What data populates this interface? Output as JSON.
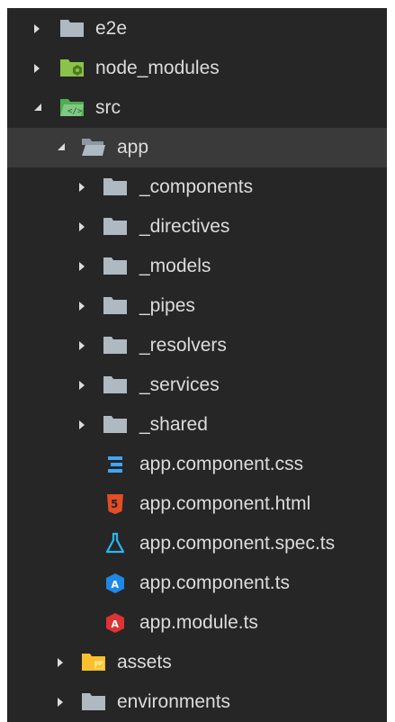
{
  "tree": {
    "items": [
      {
        "label": "e2e",
        "icon": "folder-icon",
        "state": "collapsed",
        "depth": 0
      },
      {
        "label": "node_modules",
        "icon": "node-folder-icon",
        "state": "collapsed",
        "depth": 0
      },
      {
        "label": "src",
        "icon": "src-folder-icon",
        "state": "expanded",
        "depth": 0
      },
      {
        "label": "app",
        "icon": "folder-open-icon",
        "state": "expanded",
        "depth": 1,
        "selected": true
      },
      {
        "label": "_components",
        "icon": "folder-icon",
        "state": "collapsed",
        "depth": 2
      },
      {
        "label": "_directives",
        "icon": "folder-icon",
        "state": "collapsed",
        "depth": 2
      },
      {
        "label": "_models",
        "icon": "folder-icon",
        "state": "collapsed",
        "depth": 2
      },
      {
        "label": "_pipes",
        "icon": "folder-icon",
        "state": "collapsed",
        "depth": 2
      },
      {
        "label": "_resolvers",
        "icon": "folder-icon",
        "state": "collapsed",
        "depth": 2
      },
      {
        "label": "_services",
        "icon": "folder-icon",
        "state": "collapsed",
        "depth": 2
      },
      {
        "label": "_shared",
        "icon": "folder-icon",
        "state": "collapsed",
        "depth": 2
      },
      {
        "label": "app.component.css",
        "icon": "css-file-icon",
        "state": "file",
        "depth": 2
      },
      {
        "label": "app.component.html",
        "icon": "html-file-icon",
        "state": "file",
        "depth": 2
      },
      {
        "label": "app.component.spec.ts",
        "icon": "test-flask-icon",
        "state": "file",
        "depth": 2
      },
      {
        "label": "app.component.ts",
        "icon": "angular-component-icon",
        "state": "file",
        "depth": 2
      },
      {
        "label": "app.module.ts",
        "icon": "angular-module-icon",
        "state": "file",
        "depth": 2
      },
      {
        "label": "assets",
        "icon": "assets-folder-icon",
        "state": "collapsed",
        "depth": 1
      },
      {
        "label": "environments",
        "icon": "folder-icon",
        "state": "collapsed",
        "depth": 1
      }
    ]
  },
  "colors": {
    "background": "#262626",
    "selected_row": "#3a3a3a",
    "text": "#dcdcdc",
    "folder": "#aeb9c2",
    "node_green": "#8bc34a",
    "css_blue": "#42a5f5",
    "html_orange": "#e44d26",
    "test_blue": "#29b6f6",
    "angular_blue": "#1e88e5",
    "angular_red": "#dd3333",
    "assets_yellow": "#fbc02d"
  }
}
